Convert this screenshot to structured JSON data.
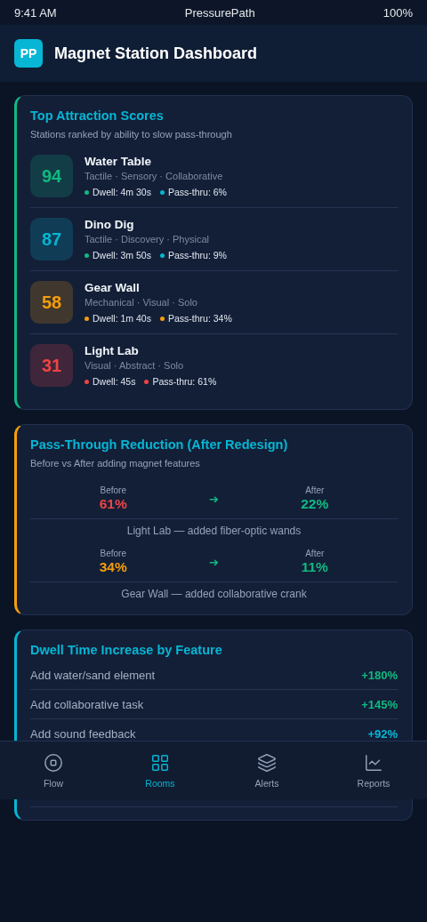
{
  "status_bar": {
    "time": "9:41 AM",
    "app": "PressurePath",
    "battery": "100%"
  },
  "header": {
    "logo": "PP",
    "title": "Magnet Station Dashboard"
  },
  "scores": {
    "title": "Top Attraction Scores",
    "subtitle": "Stations ranked by ability to slow pass-through",
    "stations": [
      {
        "score": "94",
        "color": "#10b981",
        "name": "Water Table",
        "tags": "Tactile · Sensory · Collaborative",
        "stats": [
          {
            "text": "Dwell: 4m 30s",
            "color": "#10b981"
          },
          {
            "text": "Pass-thru: 6%",
            "color": "#06b6d4"
          }
        ]
      },
      {
        "score": "87",
        "color": "#06b6d4",
        "name": "Dino Dig",
        "tags": "Tactile · Discovery · Physical",
        "stats": [
          {
            "text": "Dwell: 3m 50s",
            "color": "#10b981"
          },
          {
            "text": "Pass-thru: 9%",
            "color": "#06b6d4"
          }
        ]
      },
      {
        "score": "58",
        "color": "#f59e0b",
        "name": "Gear Wall",
        "tags": "Mechanical · Visual · Solo",
        "stats": [
          {
            "text": "Dwell: 1m 40s",
            "color": "#f59e0b"
          },
          {
            "text": "Pass-thru: 34%",
            "color": "#f59e0b"
          }
        ]
      },
      {
        "score": "31",
        "color": "#ef4444",
        "name": "Light Lab",
        "tags": "Visual · Abstract · Solo",
        "stats": [
          {
            "text": "Dwell: 45s",
            "color": "#ef4444"
          },
          {
            "text": "Pass-thru: 61%",
            "color": "#ef4444"
          }
        ]
      }
    ]
  },
  "reduction": {
    "title": "Pass-Through Reduction (After Redesign)",
    "subtitle": "Before vs After adding magnet features",
    "items": [
      {
        "before_label": "Before",
        "before": {
          "text": "61%",
          "color": "#ef4444"
        },
        "arrow": "➔",
        "after_label": "After",
        "after": {
          "text": "22%",
          "color": "#10b981"
        },
        "note": "Light Lab — added fiber-optic wands"
      },
      {
        "before_label": "Before",
        "before": {
          "text": "34%",
          "color": "#f59e0b"
        },
        "arrow": "➔",
        "after_label": "After",
        "after": {
          "text": "11%",
          "color": "#10b981"
        },
        "note": "Gear Wall — added collaborative crank"
      }
    ]
  },
  "dwell": {
    "title": "Dwell Time Increase by Feature",
    "rows": [
      {
        "label": "Add water/sand element",
        "value": "+180%",
        "color": "#10b981"
      },
      {
        "label": "Add collaborative task",
        "value": "+145%",
        "color": "#10b981"
      },
      {
        "label": "Add sound feedback",
        "value": "+92%",
        "color": "#06b6d4"
      }
    ]
  },
  "nav": [
    {
      "label": "Flow",
      "kind": "stop",
      "selected": false
    },
    {
      "label": "Rooms",
      "kind": "grid",
      "selected": true
    },
    {
      "label": "Alerts",
      "kind": "layers",
      "selected": false
    },
    {
      "label": "Reports",
      "kind": "chart",
      "selected": false
    }
  ]
}
